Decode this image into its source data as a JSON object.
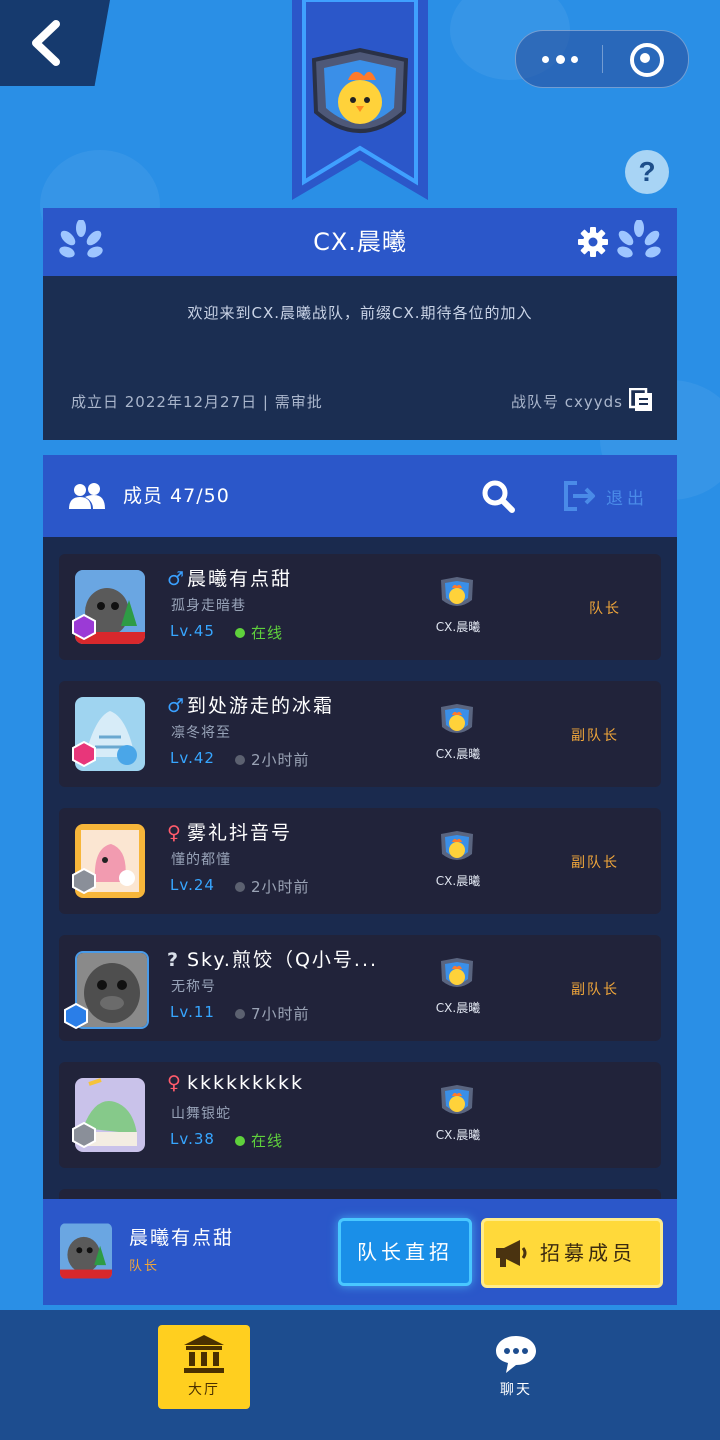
{
  "window": {
    "back_icon": "chevron-left-icon",
    "more_icon": "more-dots-icon",
    "close_icon": "target-close-icon"
  },
  "banner": {
    "emblem": "chick-shield-emblem"
  },
  "help": {
    "label": "?"
  },
  "team": {
    "name": "CX.晨曦",
    "description": "欢迎来到CX.晨曦战队，前缀CX.期待各位的加入",
    "founded_text": "成立日 2022年12月27日 | 需审批",
    "team_id_text": "战队号 cxyyds"
  },
  "members": {
    "count_label": "成员 47/50",
    "exit_label": "退出",
    "list": [
      {
        "gender": "♂",
        "gender_color": "#3aa0ff",
        "name": "晨曦有点甜",
        "title": "孤身走暗巷",
        "level": "Lv.45",
        "status": "在线",
        "online": true,
        "team": "CX.晨曦",
        "role": "队长"
      },
      {
        "gender": "♂",
        "gender_color": "#3aa0ff",
        "name": "到处游走的冰霜",
        "title": "凛冬将至",
        "level": "Lv.42",
        "status": "2小时前",
        "online": false,
        "team": "CX.晨曦",
        "role": "副队长"
      },
      {
        "gender": "♀",
        "gender_color": "#ff5b6b",
        "name": "雾礼抖音号",
        "title": "懂的都懂",
        "level": "Lv.24",
        "status": "2小时前",
        "online": false,
        "team": "CX.晨曦",
        "role": "副队长"
      },
      {
        "gender": "?",
        "gender_color": "#d9dfe9",
        "name": "Sky.煎饺（Q小号...",
        "title": "无称号",
        "level": "Lv.11",
        "status": "7小时前",
        "online": false,
        "team": "CX.晨曦",
        "role": "副队长"
      },
      {
        "gender": "♀",
        "gender_color": "#ff5b6b",
        "name": "kkkkkkkkk",
        "title": "山舞银蛇",
        "level": "Lv.38",
        "status": "在线",
        "online": true,
        "team": "CX.晨曦",
        "role": ""
      }
    ]
  },
  "footer": {
    "self_name": "晨曦有点甜",
    "self_role": "队长",
    "direct_recruit_label": "队长直招",
    "recruit_label": "招募成员"
  },
  "nav": {
    "hall_label": "大厅",
    "chat_label": "聊天"
  },
  "colors": {
    "accent_blue": "#2b57c9",
    "panel_dark": "#1b2e52",
    "gold": "#ffd93a",
    "role_orange": "#f0a63a",
    "online_green": "#5fd13c"
  }
}
